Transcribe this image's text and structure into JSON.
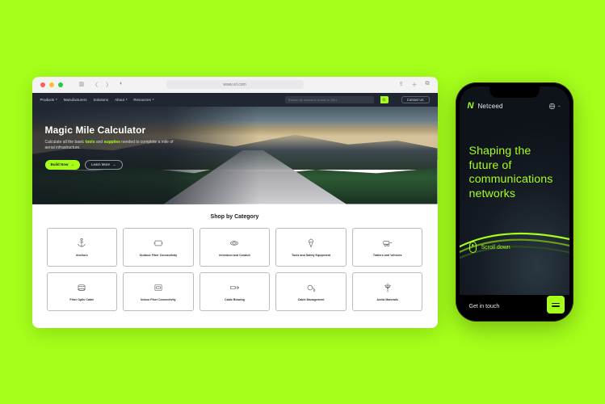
{
  "browser": {
    "url": "www.url.com",
    "nav": {
      "items": [
        "Products",
        "Manufacturers",
        "Solutions",
        "About",
        "Resources"
      ],
      "search_placeholder": "Search by keyword, brand or SKU",
      "contact": "Contact Us"
    },
    "hero": {
      "title": "Magic Mile Calculator",
      "sub_pre": "Calculate all the basic ",
      "sub_tools": "tools",
      "sub_mid": " and ",
      "sub_supplies": "supplies",
      "sub_post": " needed to complete a mile of aerial infrastructure.",
      "btn_primary": "Build Now",
      "btn_outline": "Learn More"
    },
    "shop": {
      "title": "Shop by Category",
      "cards": [
        {
          "label": "Anchors"
        },
        {
          "label": "Outdoor Fiber Connectivity"
        },
        {
          "label": "Innerduct and Conduit"
        },
        {
          "label": "Tools and Safety Equipment"
        },
        {
          "label": "Trailers and Vehicles"
        },
        {
          "label": "Fiber Optic Cable"
        },
        {
          "label": "Indoor Fiber Connectivity"
        },
        {
          "label": "Cable Blowing"
        },
        {
          "label": "Cable Management"
        },
        {
          "label": "Aerial Materials"
        }
      ]
    }
  },
  "phone": {
    "brand": "Netceed",
    "hero_l1": "Shaping the",
    "hero_l2": "future of",
    "hero_l3": "communications",
    "hero_l4": "networks",
    "scroll": "Scroll down",
    "get_in_touch": "Get in touch"
  },
  "colors": {
    "accent": "#a5ff1a"
  }
}
